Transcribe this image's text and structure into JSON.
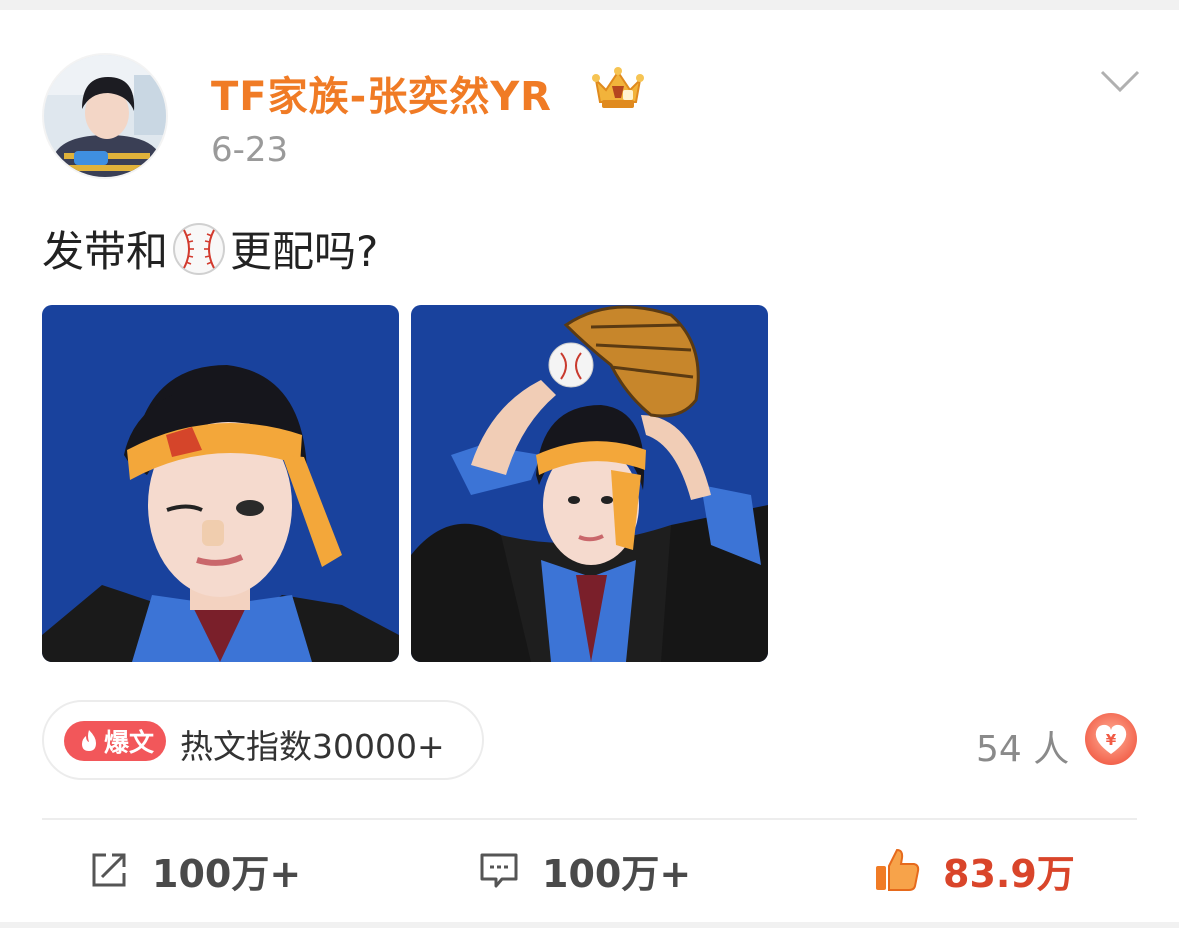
{
  "post": {
    "author_name": "TF家族-张奕然YR",
    "date": "6-23",
    "text_before_emoji": "发带和",
    "text_emoji": "baseball-emoji",
    "text_after_emoji": "更配吗?"
  },
  "hot": {
    "badge_label": "爆文",
    "index_text": "热文指数30000+"
  },
  "reward": {
    "count_text": "54 人",
    "button_symbol": "¥"
  },
  "actions": {
    "share_count": "100万+",
    "comment_count": "100万+",
    "like_count": "83.9万"
  },
  "colors": {
    "author_orange": "#f07b25",
    "hot_red": "#f2575a",
    "like_red": "#d9452a",
    "photo_blue": "#1c48a8"
  },
  "icons": [
    "vip-crown-icon",
    "chevron-down-icon",
    "flame-icon",
    "heart-yuan-icon",
    "share-icon",
    "comment-icon",
    "thumbs-up-icon"
  ]
}
